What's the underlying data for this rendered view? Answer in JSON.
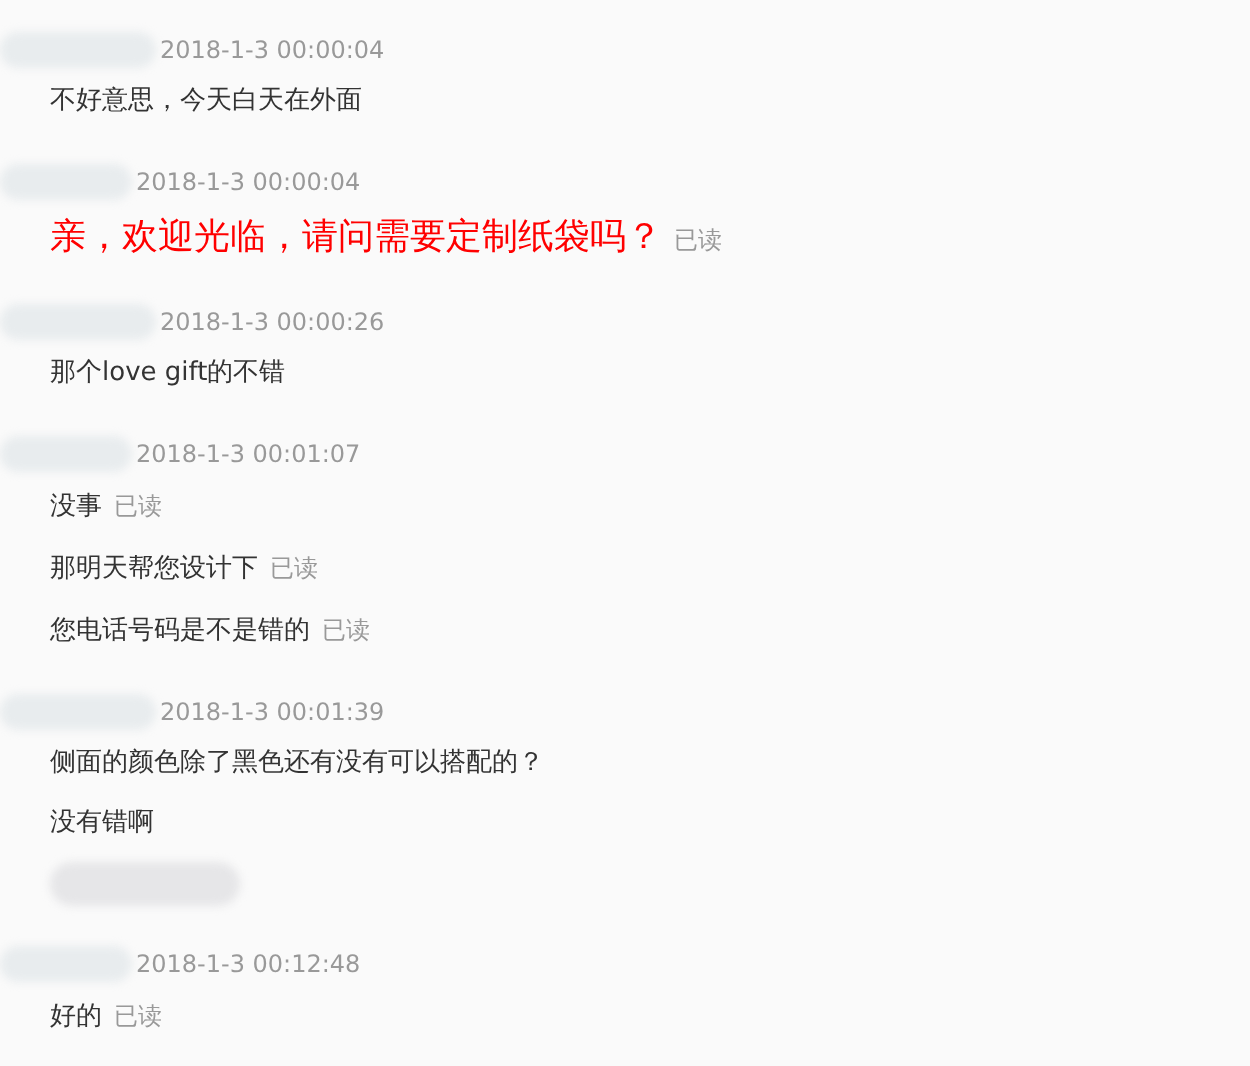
{
  "conversation": [
    {
      "time": "2018-1-3 00:00:04",
      "messages": [
        {
          "kind": "text",
          "text": "不好意思，今天白天在外面"
        }
      ]
    },
    {
      "time": "2018-1-3 00:00:04",
      "messages": [
        {
          "kind": "highlight",
          "text": "亲，欢迎光临，请问需要定制纸袋吗？",
          "status": "已读"
        }
      ]
    },
    {
      "time": "2018-1-3 00:00:26",
      "messages": [
        {
          "kind": "text",
          "text": "那个love gift的不错"
        }
      ]
    },
    {
      "time": "2018-1-3 00:01:07",
      "messages": [
        {
          "kind": "text",
          "text": "没事",
          "status": "已读"
        },
        {
          "kind": "text",
          "text": "那明天帮您设计下",
          "status": "已读"
        },
        {
          "kind": "text",
          "text": "您电话号码是不是错的",
          "status": "已读"
        }
      ]
    },
    {
      "time": "2018-1-3 00:01:39",
      "messages": [
        {
          "kind": "text",
          "text": "侧面的颜色除了黑色还有没有可以搭配的？"
        },
        {
          "kind": "text",
          "text": "没有错啊"
        },
        {
          "kind": "blurred"
        }
      ]
    },
    {
      "time": "2018-1-3 00:12:48",
      "messages": [
        {
          "kind": "text",
          "text": "好的",
          "status": "已读"
        }
      ]
    }
  ]
}
